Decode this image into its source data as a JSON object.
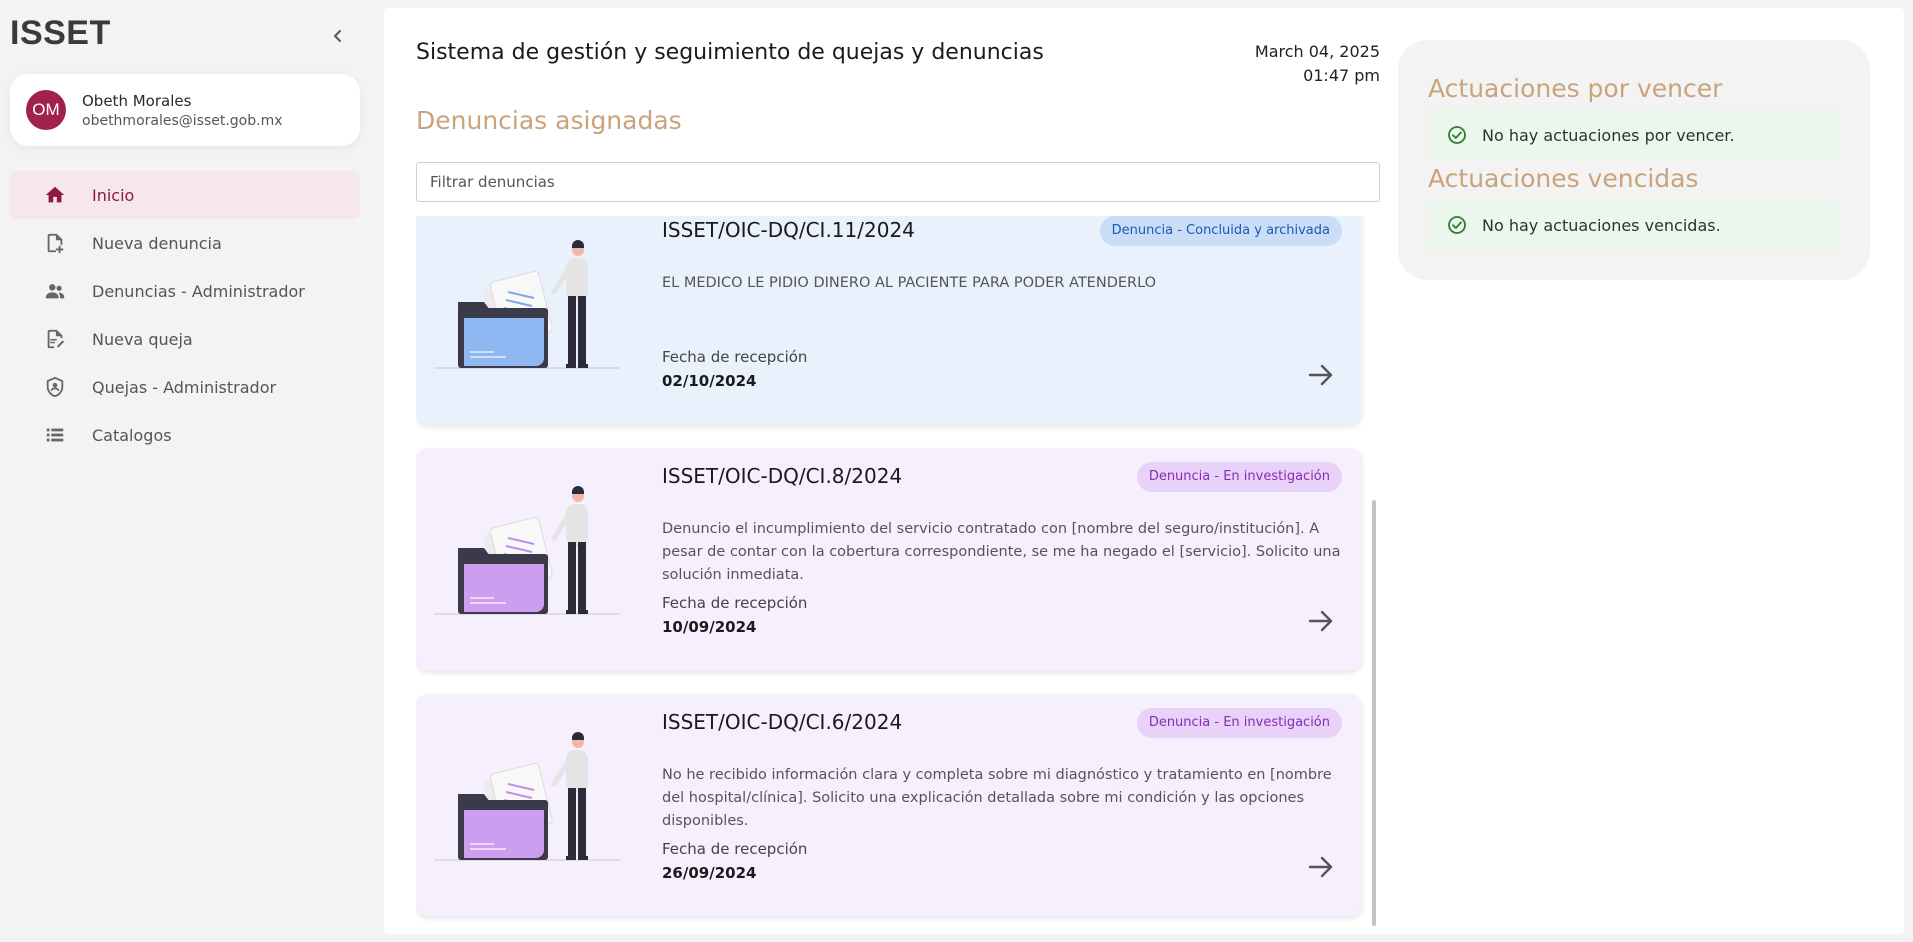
{
  "app": {
    "logo": "ISSET"
  },
  "user": {
    "initials": "OM",
    "name": "Obeth Morales",
    "email": "obethmorales@isset.gob.mx"
  },
  "nav": {
    "items": [
      {
        "label": "Inicio",
        "icon": "home-icon",
        "active": true
      },
      {
        "label": "Nueva denuncia",
        "icon": "file-plus-icon",
        "active": false
      },
      {
        "label": "Denuncias - Administrador",
        "icon": "users-icon",
        "active": false
      },
      {
        "label": "Nueva queja",
        "icon": "file-edit-icon",
        "active": false
      },
      {
        "label": "Quejas - Administrador",
        "icon": "shield-user-icon",
        "active": false
      },
      {
        "label": "Catalogos",
        "icon": "list-icon",
        "active": false
      }
    ]
  },
  "header": {
    "title": "Sistema de gestión y seguimiento de quejas y denuncias",
    "date": "March 04, 2025",
    "time": "01:47 pm"
  },
  "main": {
    "section_title": "Denuncias asignadas",
    "filter_placeholder": "Filtrar denuncias",
    "date_label": "Fecha de recepción",
    "cards": [
      {
        "code": "ISSET/OIC-DQ/CI.11/2024",
        "status": "Denuncia - Concluida y archivada",
        "description": "EL MEDICO LE PIDIO DINERO AL PACIENTE PARA PODER ATENDERLO",
        "date": "02/10/2024",
        "theme": "blue"
      },
      {
        "code": "ISSET/OIC-DQ/CI.8/2024",
        "status": "Denuncia - En investigación",
        "description": "Denuncio el incumplimiento del servicio contratado con [nombre del seguro/institución]. A pesar de contar con la cobertura correspondiente, se me ha negado el [servicio]. Solicito una solución inmediata.",
        "date": "10/09/2024",
        "theme": "purple"
      },
      {
        "code": "ISSET/OIC-DQ/CI.6/2024",
        "status": "Denuncia - En investigación",
        "description": "No he recibido información clara y completa sobre mi diagnóstico y tratamiento en [nombre del hospital/clínica]. Solicito una explicación detallada sobre mi condición y las opciones disponibles.",
        "date": "26/09/2024",
        "theme": "purple"
      }
    ]
  },
  "right_panel": {
    "por_vencer_title": "Actuaciones por vencer",
    "por_vencer_msg": "No hay actuaciones por vencer.",
    "vencidas_title": "Actuaciones vencidas",
    "vencidas_msg": "No hay actuaciones vencidas."
  },
  "colors": {
    "brand": "#a0214a",
    "accent_title": "#c9a47a",
    "success_bg": "#ebf6ec",
    "card_blue": "#e9f1fd",
    "card_purple": "#f6effd"
  }
}
